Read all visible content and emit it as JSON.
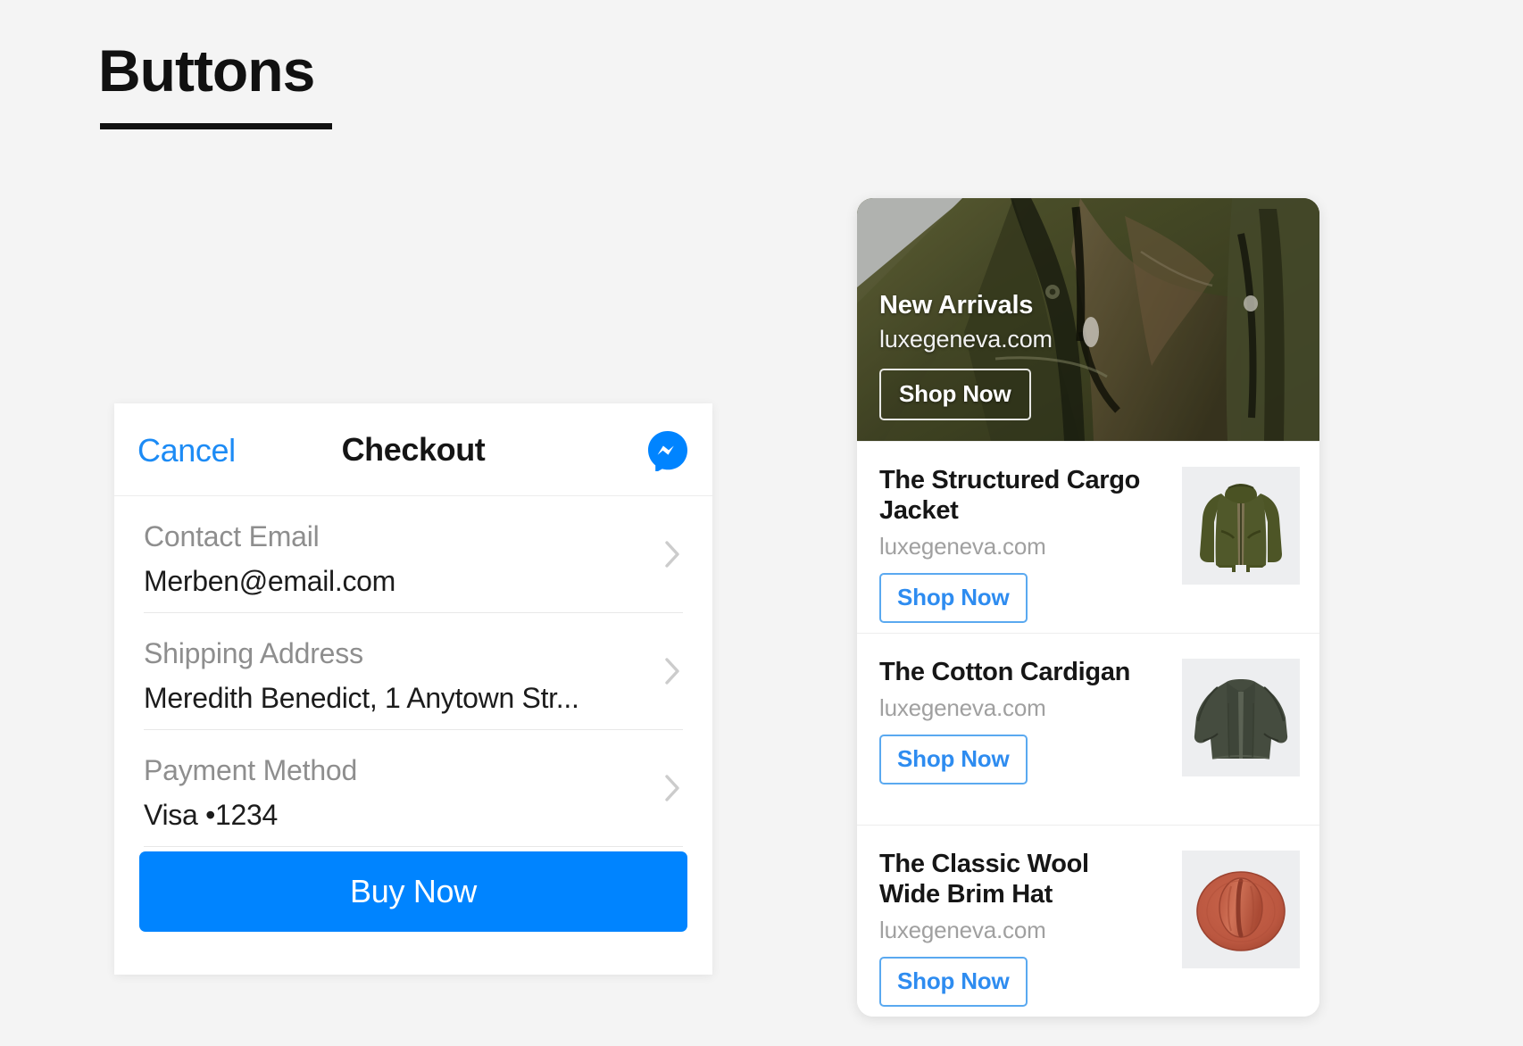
{
  "page": {
    "title": "Buttons",
    "background_color": "#f4f4f4"
  },
  "colors": {
    "accent_blue": "#0084ff",
    "link_blue": "#1c8bf5",
    "outline_blue": "#5aa9f0",
    "olive": "#4a5223",
    "cardigan_green": "#454c3f",
    "hat_terracotta": "#c0573c"
  },
  "checkout_card": {
    "header": {
      "cancel_label": "Cancel",
      "title": "Checkout",
      "messenger_icon": "messenger-icon"
    },
    "rows": [
      {
        "label": "Contact Email",
        "value": "Merben@email.com",
        "chevron_icon": "chevron-right-icon"
      },
      {
        "label": "Shipping Address",
        "value": "Meredith Benedict, 1 Anytown Str...",
        "chevron_icon": "chevron-right-icon"
      },
      {
        "label": "Payment Method",
        "value": "Visa •1234",
        "chevron_icon": "chevron-right-icon"
      }
    ],
    "primary_button": {
      "label": "Buy Now"
    }
  },
  "product_card": {
    "hero": {
      "title": "New Arrivals",
      "subtitle": "luxegeneva.com",
      "cta_label": "Shop Now",
      "image_alt": "olive-green-jacket-closeup"
    },
    "products": [
      {
        "name": "The Structured Cargo Jacket",
        "domain": "luxegeneva.com",
        "cta_label": "Shop Now",
        "thumb": "olive-cargo-jacket"
      },
      {
        "name": "The Cotton Cardigan",
        "domain": "luxegeneva.com",
        "cta_label": "Shop Now",
        "thumb": "dark-green-cardigan"
      },
      {
        "name": "The Classic Wool Wide Brim Hat",
        "domain": "luxegeneva.com",
        "cta_label": "Shop Now",
        "thumb": "terracotta-wide-brim-hat"
      }
    ]
  }
}
